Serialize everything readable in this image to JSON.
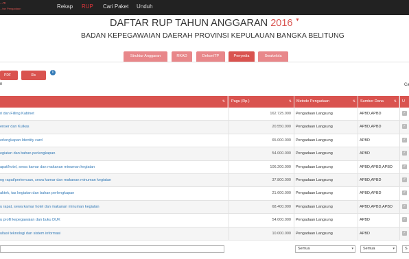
{
  "navbar": {
    "brand_line1": "...m",
    "brand_line2": "...tan Pengadaan",
    "items": [
      "Rekap",
      "RUP",
      "Cari Paket",
      "Unduh"
    ],
    "active_index": 1
  },
  "header": {
    "title": "DAFTAR RUP TAHUN ANGGARAN",
    "year": "2016",
    "year_marker": "▼",
    "subtitle": "BADAN KEPEGAWAIAN DAERAH PROVINSI KEPULAUAN BANGKA BELITUNG"
  },
  "tabs": [
    "Struktur Anggaran",
    "RKAD",
    "Dekon/TP",
    "Penyedia",
    "Swakelola"
  ],
  "active_tab": "Penyedia",
  "export": {
    "pdf_label": "PDF",
    "xls_label": "Xls"
  },
  "info_icon": "i",
  "labels": {
    "left": "n",
    "right": "Ca"
  },
  "table": {
    "columns": [
      "",
      "Pagu (Rp.)",
      "Metode Pengadaan",
      "Sumber Dana",
      "U"
    ],
    "rows": [
      {
        "name": "ri dan Filling Kabinet",
        "pagu": "162.725.000",
        "metode": "Pengadaan Langsung",
        "sumber": "APBD,APBD"
      },
      {
        "name": "enser dan Kulkas",
        "pagu": "20.550.000",
        "metode": "Pengadaan Langsung",
        "sumber": "APBD,APBD"
      },
      {
        "name": "erlengkapan Identity card",
        "pagu": "65.000.000",
        "metode": "Pengadaan Langsung",
        "sumber": "APBD"
      },
      {
        "name": "egiatan dan bahan perlengkapan",
        "pagu": "54.000.000",
        "metode": "Pengadaan Langsung",
        "sumber": "APBD"
      },
      {
        "name": "apat/hotel, sewa kamar dan makanan minuman kegiatan",
        "pagu": "106.200.000",
        "metode": "Pengadaan Langsung",
        "sumber": "APBD,APBD,APBD"
      },
      {
        "name": "ng rapat/pertemuan, sewa kamar dan makanan minuman kegiatan",
        "pagu": "37.800.000",
        "metode": "Pengadaan Langsung",
        "sumber": "APBD,APBD"
      },
      {
        "name": "aktek, tas kegiatan dan bahan perlengkapan",
        "pagu": "21.600.000",
        "metode": "Pengadaan Langsung",
        "sumber": "APBD,APBD"
      },
      {
        "name": "u rapat, sewa kamar hotel dan makanan minuman kegiatan",
        "pagu": "68.400.000",
        "metode": "Pengadaan Langsung",
        "sumber": "APBD,APBD,APBD"
      },
      {
        "name": "u profil kepegawaian dan buku DUK",
        "pagu": "54.000.000",
        "metode": "Pengadaan Langsung",
        "sumber": "APBD"
      },
      {
        "name": "ultasi teknologi dan sistem informasi",
        "pagu": "10.000.000",
        "metode": "Pengadaan Langsung",
        "sumber": "APBD"
      }
    ]
  },
  "filters": {
    "metode_value": "Semua",
    "sumber_value": "Semua",
    "extra_value": "S"
  },
  "colors": {
    "accent": "#d9534f",
    "tab_inactive": "#e8878a",
    "navbar": "#222222",
    "link": "#337ab7"
  }
}
